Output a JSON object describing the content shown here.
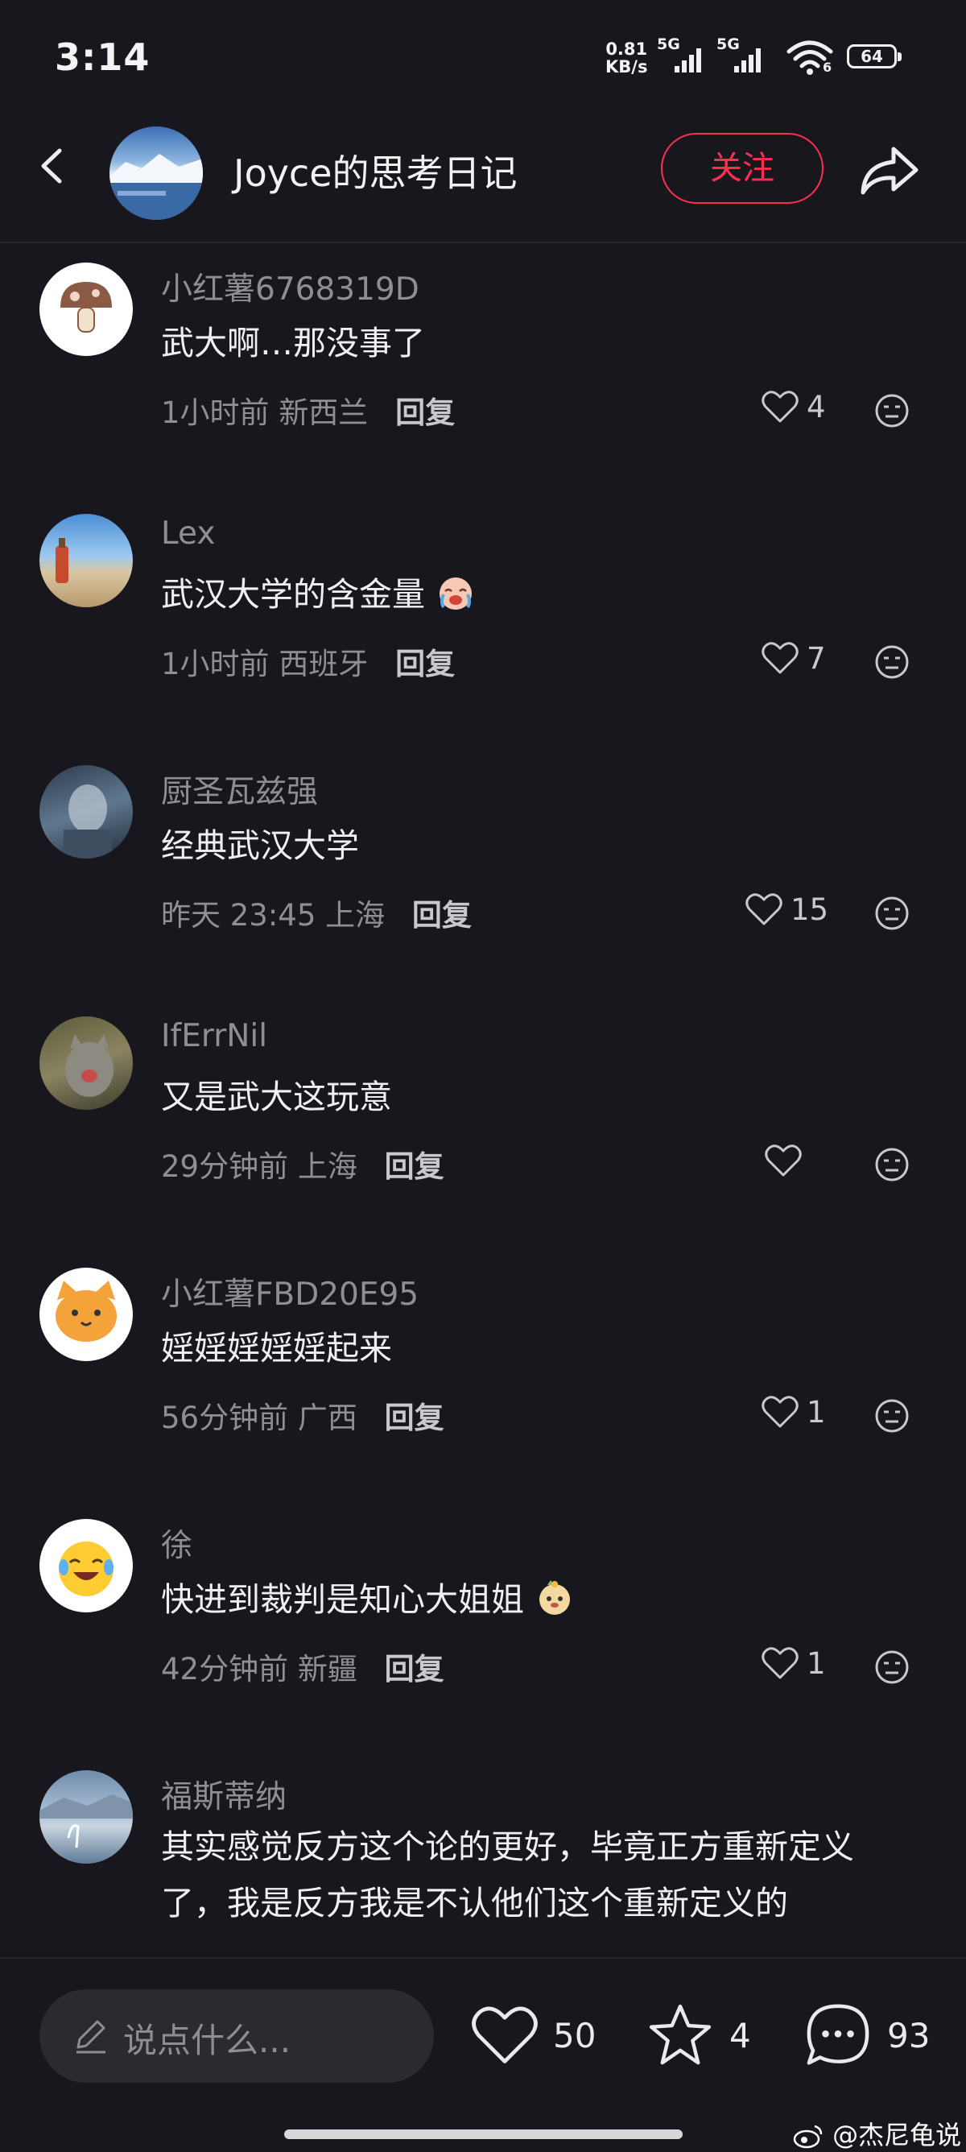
{
  "status_bar": {
    "time": "3:14",
    "net_speed_value": "0.81",
    "net_speed_unit": "KB/s",
    "signal1_label": "5G",
    "signal2_label": "5G",
    "wifi_badge": "6",
    "battery": "64"
  },
  "header": {
    "author_name": "Joyce的思考日记",
    "follow_label": "关注"
  },
  "comments": [
    {
      "username": "小红薯6768319D",
      "text": "武大啊…那没事了",
      "time": "1小时前",
      "location": "新西兰",
      "reply": "回复",
      "likes": "4"
    },
    {
      "username": "Lex",
      "text": "武汉大学的含金量",
      "time": "1小时前",
      "location": "西班牙",
      "reply": "回复",
      "likes": "7"
    },
    {
      "username": "厨圣瓦兹强",
      "text": "经典武汉大学",
      "time": "昨天 23:45",
      "location": "上海",
      "reply": "回复",
      "likes": "15"
    },
    {
      "username": "IfErrNil",
      "text": "又是武大这玩意",
      "time": "29分钟前",
      "location": "上海",
      "reply": "回复",
      "likes": ""
    },
    {
      "username": "小红薯FBD20E95",
      "text": "婬婬婬婬婬起来",
      "time": "56分钟前",
      "location": "广西",
      "reply": "回复",
      "likes": "1"
    },
    {
      "username": "徐",
      "text": "快进到裁判是知心大姐姐",
      "time": "42分钟前",
      "location": "新疆",
      "reply": "回复",
      "likes": "1"
    },
    {
      "username": "福斯蒂纳",
      "text_line1": "其实感觉反方这个论的更好，毕竟正方重新定义",
      "text_line2": "了，我是反方我是不认他们这个重新定义的"
    }
  ],
  "bottom_bar": {
    "input_placeholder": "说点什么...",
    "likes": "50",
    "stars": "4",
    "comments": "93"
  },
  "watermark": "@杰尼龟说"
}
